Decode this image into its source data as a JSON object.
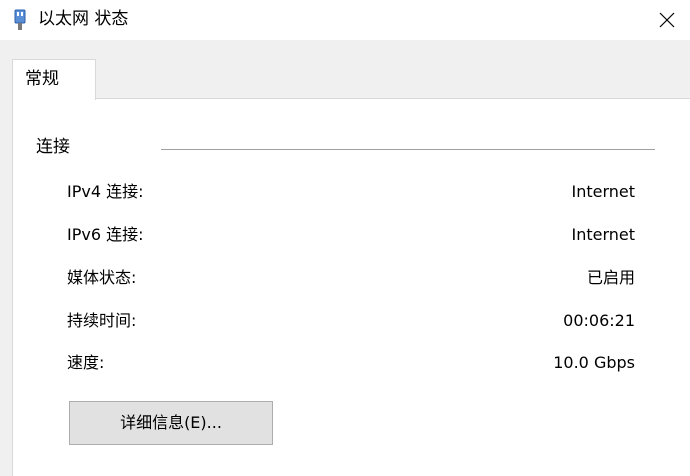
{
  "window": {
    "title": "以太网 状态",
    "icon": "network-adapter-icon",
    "close_icon": "close-icon"
  },
  "tabs": [
    {
      "label": "常规",
      "selected": true
    }
  ],
  "connection": {
    "section_title": "连接",
    "rows": [
      {
        "label": "IPv4 连接:",
        "value": "Internet"
      },
      {
        "label": "IPv6 连接:",
        "value": "Internet"
      },
      {
        "label": "媒体状态:",
        "value": "已启用"
      },
      {
        "label": "持续时间:",
        "value": "00:06:21"
      },
      {
        "label": "速度:",
        "value": "10.0 Gbps"
      }
    ]
  },
  "buttons": {
    "details_label": "详细信息(E)..."
  },
  "colors": {
    "window_bg": "#f0f0f0",
    "panel_bg": "#ffffff",
    "button_bg": "#e1e1e1",
    "button_border": "#adadad"
  }
}
